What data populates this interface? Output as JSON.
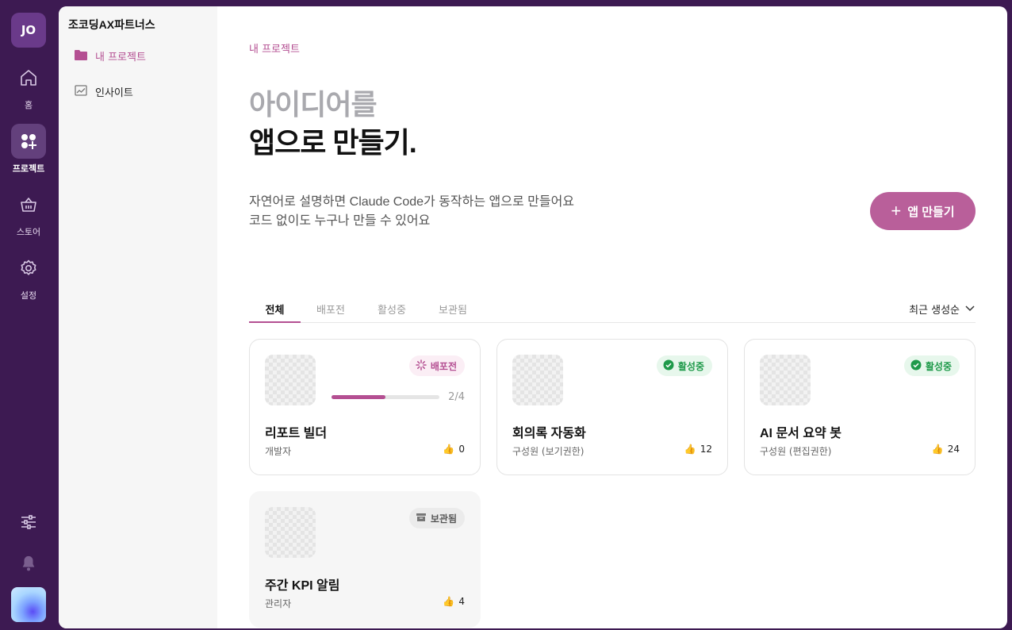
{
  "user": {
    "initials": "JO"
  },
  "rail": {
    "items": [
      {
        "label": "홈",
        "icon": "home-icon"
      },
      {
        "label": "프로젝트",
        "icon": "projects-icon"
      },
      {
        "label": "스토어",
        "icon": "store-basket-icon"
      },
      {
        "label": "설정",
        "icon": "settings-gear-icon"
      }
    ],
    "bottom_icons": [
      "sliders-icon",
      "bell-icon"
    ]
  },
  "subnav": {
    "org_name": "조코딩AX파트너스",
    "items": [
      {
        "label": "내 프로젝트",
        "icon": "folder-icon"
      },
      {
        "label": "인사이트",
        "icon": "chart-image-icon"
      }
    ]
  },
  "main": {
    "breadcrumb": "내 프로젝트",
    "hero": {
      "line1": "아이디어를",
      "line2": "앱으로 만들기."
    },
    "description": {
      "line1": "자연어로 설명하면 Claude Code가 동작하는 앱으로 만들어요",
      "line2": "코드 없이도 누구나 만들 수 있어요"
    },
    "create_button": "앱 만들기",
    "tabs": [
      "전체",
      "배포전",
      "활성중",
      "보관됨"
    ],
    "sort": "최근 생성순",
    "cards": [
      {
        "title": "리포트 빌더",
        "role": "개발자",
        "likes": "0",
        "status": "배포전",
        "progress_text": "2/4",
        "progress": 0.5
      },
      {
        "title": "회의록 자동화",
        "role": "구성원 (보기권한)",
        "likes": "12",
        "status": "활성중"
      },
      {
        "title": "AI 문서 요약 봇",
        "role": "구성원 (편집권한)",
        "likes": "24",
        "status": "활성중"
      },
      {
        "title": "주간 KPI 알림",
        "role": "관리자",
        "likes": "4",
        "status": "보관됨"
      }
    ]
  },
  "colors": {
    "accent": "#b44f92",
    "sidebar_bg": "#3d1a52",
    "active_green": "#1f9a4a",
    "like_orange": "#f0a22e"
  }
}
